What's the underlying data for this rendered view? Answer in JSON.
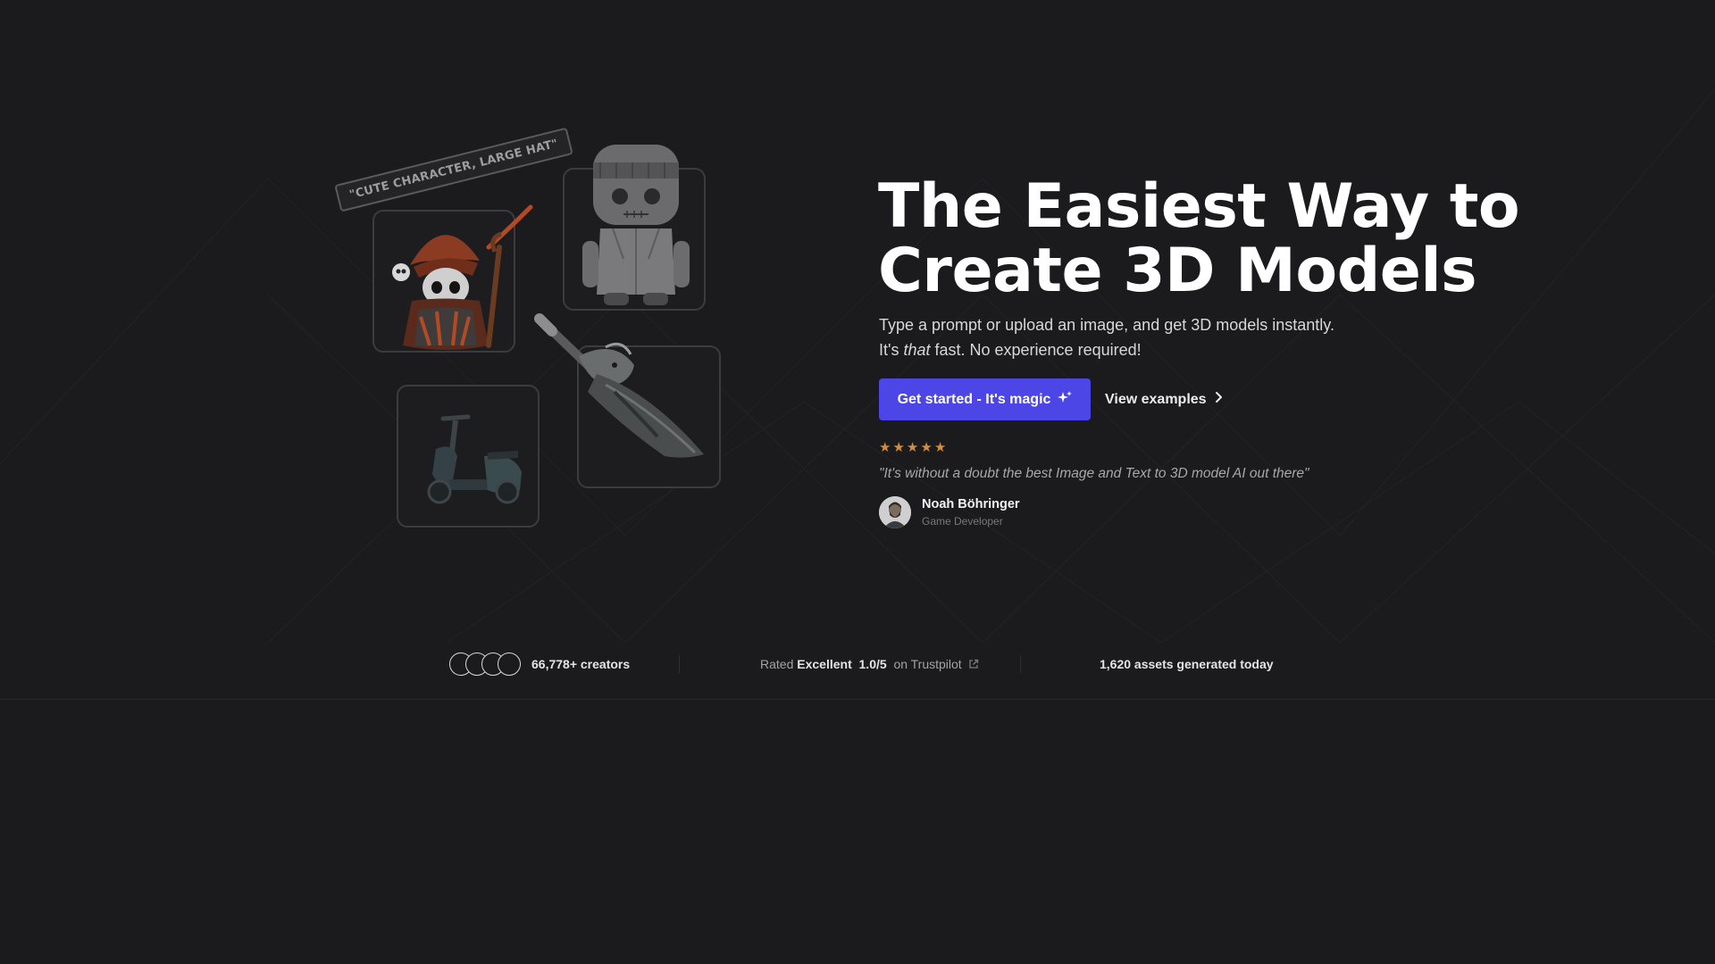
{
  "illustrations": {
    "prompt_tag": "\"CUTE CHARACTER, LARGE HAT\""
  },
  "hero": {
    "title_line1": "The Easiest Way to",
    "title_line2": "Create 3D Models",
    "subtitle_line1": "Type a prompt or upload an image, and get 3D models instantly.",
    "subtitle_line2_prefix": "It's ",
    "subtitle_line2_emphasis": "that",
    "subtitle_line2_suffix": " fast. No experience required!",
    "cta_label": "Get started - It's magic",
    "cta_icon": "sparkle-icon",
    "secondary_label": "View examples",
    "secondary_icon": "chevron-right-icon"
  },
  "testimonial": {
    "rating": 5,
    "stars": [
      "★",
      "★",
      "★",
      "★",
      "★"
    ],
    "quote": "\"It's without a doubt the best Image and Text to 3D model AI out there\"",
    "author_name": "Noah Böhringer",
    "author_role": "Game Developer"
  },
  "stats": {
    "creators_value": "66,778+",
    "creators_label": "creators",
    "rating_prefix": "Rated",
    "rating_word": "Excellent",
    "rating_score": "1.0/5",
    "rating_suffix": "on Trustpilot",
    "assets_text": "1,620 assets generated today"
  },
  "colors": {
    "background": "#1b1b1e",
    "accent": "#4b46e5",
    "star": "#d38e39"
  }
}
